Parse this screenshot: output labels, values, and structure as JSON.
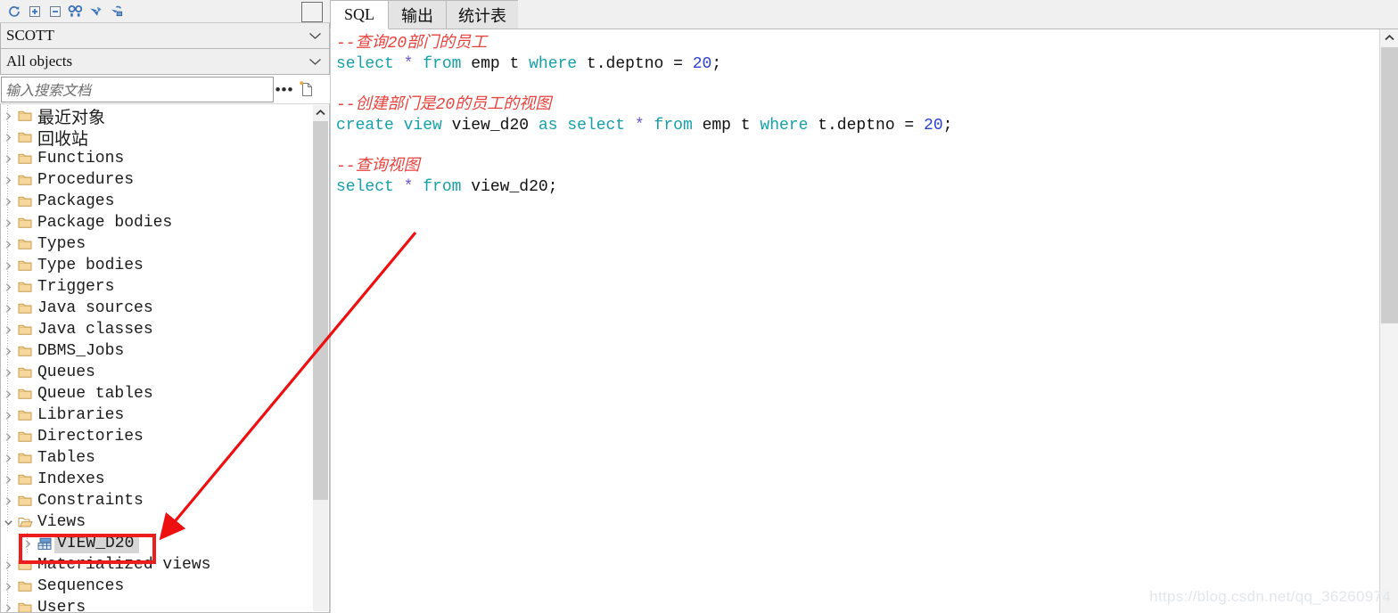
{
  "sidebar": {
    "toolbar": {
      "buttons": [
        {
          "name": "refresh-icon",
          "title": "Refresh"
        },
        {
          "name": "expand-all-icon",
          "title": "Expand"
        },
        {
          "name": "collapse-all-icon",
          "title": "Collapse"
        },
        {
          "name": "find-icon",
          "title": "Find"
        },
        {
          "name": "filter-icon",
          "title": "Filter"
        },
        {
          "name": "lock-icon",
          "title": "Lock"
        }
      ],
      "square_button_label": ""
    },
    "schema_select": {
      "value": "SCOTT",
      "chevron": "chevron-down-icon"
    },
    "filter_select": {
      "value": "All objects",
      "chevron": "chevron-down-icon"
    },
    "search": {
      "value": "",
      "placeholder": "输入搜索文档",
      "more_label": "•••",
      "new_doc_icon": "new-document-icon"
    },
    "tree": [
      {
        "label": "最近对象",
        "cjk": true,
        "icon": "folder-icon",
        "expanded": false,
        "child": false,
        "selected": false
      },
      {
        "label": "回收站",
        "cjk": true,
        "icon": "folder-icon",
        "expanded": false,
        "child": false,
        "selected": false
      },
      {
        "label": "Functions",
        "cjk": false,
        "icon": "folder-icon",
        "expanded": false,
        "child": false,
        "selected": false
      },
      {
        "label": "Procedures",
        "cjk": false,
        "icon": "folder-icon",
        "expanded": false,
        "child": false,
        "selected": false
      },
      {
        "label": "Packages",
        "cjk": false,
        "icon": "folder-icon",
        "expanded": false,
        "child": false,
        "selected": false
      },
      {
        "label": "Package bodies",
        "cjk": false,
        "icon": "folder-icon",
        "expanded": false,
        "child": false,
        "selected": false
      },
      {
        "label": "Types",
        "cjk": false,
        "icon": "folder-icon",
        "expanded": false,
        "child": false,
        "selected": false
      },
      {
        "label": "Type bodies",
        "cjk": false,
        "icon": "folder-icon",
        "expanded": false,
        "child": false,
        "selected": false
      },
      {
        "label": "Triggers",
        "cjk": false,
        "icon": "folder-icon",
        "expanded": false,
        "child": false,
        "selected": false
      },
      {
        "label": "Java sources",
        "cjk": false,
        "icon": "folder-icon",
        "expanded": false,
        "child": false,
        "selected": false
      },
      {
        "label": "Java classes",
        "cjk": false,
        "icon": "folder-icon",
        "expanded": false,
        "child": false,
        "selected": false
      },
      {
        "label": "DBMS_Jobs",
        "cjk": false,
        "icon": "folder-icon",
        "expanded": false,
        "child": false,
        "selected": false
      },
      {
        "label": "Queues",
        "cjk": false,
        "icon": "folder-icon",
        "expanded": false,
        "child": false,
        "selected": false
      },
      {
        "label": "Queue tables",
        "cjk": false,
        "icon": "folder-icon",
        "expanded": false,
        "child": false,
        "selected": false
      },
      {
        "label": "Libraries",
        "cjk": false,
        "icon": "folder-icon",
        "expanded": false,
        "child": false,
        "selected": false
      },
      {
        "label": "Directories",
        "cjk": false,
        "icon": "folder-icon",
        "expanded": false,
        "child": false,
        "selected": false
      },
      {
        "label": "Tables",
        "cjk": false,
        "icon": "folder-icon",
        "expanded": false,
        "child": false,
        "selected": false
      },
      {
        "label": "Indexes",
        "cjk": false,
        "icon": "folder-icon",
        "expanded": false,
        "child": false,
        "selected": false
      },
      {
        "label": "Constraints",
        "cjk": false,
        "icon": "folder-icon",
        "expanded": false,
        "child": false,
        "selected": false
      },
      {
        "label": "Views",
        "cjk": false,
        "icon": "folder-open-icon",
        "expanded": true,
        "child": false,
        "selected": false
      },
      {
        "label": "VIEW_D20",
        "cjk": false,
        "icon": "view-table-icon",
        "expanded": false,
        "child": true,
        "selected": true
      },
      {
        "label": "Materialized views",
        "cjk": false,
        "icon": "folder-icon",
        "expanded": false,
        "child": false,
        "selected": false
      },
      {
        "label": "Sequences",
        "cjk": false,
        "icon": "folder-icon",
        "expanded": false,
        "child": false,
        "selected": false
      },
      {
        "label": "Users",
        "cjk": false,
        "icon": "folder-icon",
        "expanded": false,
        "child": false,
        "selected": false
      }
    ],
    "scrollbar": {
      "up_icon": "chevron-up-icon"
    }
  },
  "editor": {
    "tabs": [
      {
        "label": "SQL",
        "active": true
      },
      {
        "label": "输出",
        "active": false
      },
      {
        "label": "统计表",
        "active": false
      }
    ],
    "lines": [
      [
        {
          "t": "--查询20部门的员工",
          "c": "cmt"
        }
      ],
      [
        {
          "t": "select",
          "c": "kw"
        },
        {
          "t": " ",
          "c": "punc"
        },
        {
          "t": "*",
          "c": "star"
        },
        {
          "t": " ",
          "c": "punc"
        },
        {
          "t": "from",
          "c": "kw"
        },
        {
          "t": " emp t ",
          "c": "id"
        },
        {
          "t": "where",
          "c": "kw"
        },
        {
          "t": " t.deptno = ",
          "c": "id"
        },
        {
          "t": "20",
          "c": "num"
        },
        {
          "t": ";",
          "c": "punc"
        }
      ],
      [],
      [
        {
          "t": "--创建部门是20的员工的视图",
          "c": "cmt"
        }
      ],
      [
        {
          "t": "create",
          "c": "kw"
        },
        {
          "t": " ",
          "c": "punc"
        },
        {
          "t": "view",
          "c": "kw"
        },
        {
          "t": " view_d20 ",
          "c": "id"
        },
        {
          "t": "as",
          "c": "kw"
        },
        {
          "t": " ",
          "c": "punc"
        },
        {
          "t": "select",
          "c": "kw"
        },
        {
          "t": " ",
          "c": "punc"
        },
        {
          "t": "*",
          "c": "star"
        },
        {
          "t": " ",
          "c": "punc"
        },
        {
          "t": "from",
          "c": "kw"
        },
        {
          "t": " emp t ",
          "c": "id"
        },
        {
          "t": "where",
          "c": "kw"
        },
        {
          "t": " t.deptno = ",
          "c": "id"
        },
        {
          "t": "20",
          "c": "num"
        },
        {
          "t": ";",
          "c": "punc"
        }
      ],
      [],
      [
        {
          "t": "--查询视图",
          "c": "cmt"
        }
      ],
      [
        {
          "t": "select",
          "c": "kw"
        },
        {
          "t": " ",
          "c": "punc"
        },
        {
          "t": "*",
          "c": "star"
        },
        {
          "t": " ",
          "c": "punc"
        },
        {
          "t": "from",
          "c": "kw"
        },
        {
          "t": " view_d20;",
          "c": "id"
        }
      ]
    ],
    "scrollbar": {
      "up_icon": "chevron-up-icon"
    }
  },
  "annotation": {
    "highlight_color": "#ee1c1c",
    "arrow_color": "#ee1010",
    "target_label": "VIEW_D20"
  },
  "watermark": {
    "text": "https://blog.csdn.net/qq_36260974"
  }
}
